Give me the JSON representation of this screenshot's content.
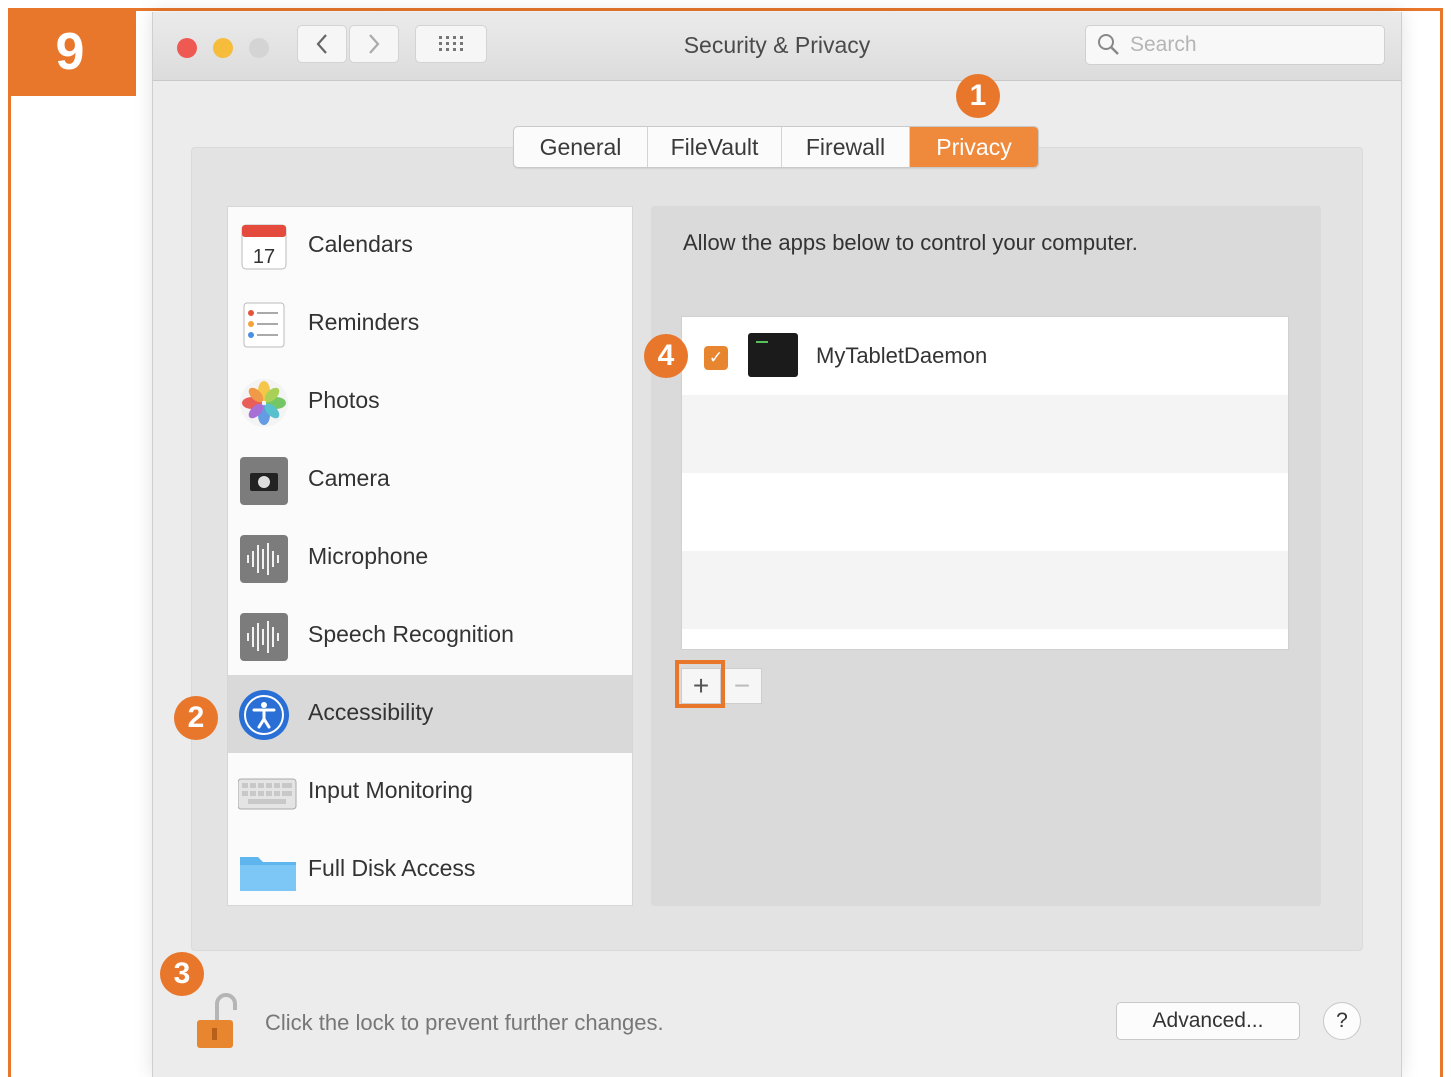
{
  "step": {
    "number": "9"
  },
  "window": {
    "title": "Security & Privacy",
    "search_placeholder": "Search"
  },
  "tabs": [
    {
      "label": "General",
      "active": false
    },
    {
      "label": "FileVault",
      "active": false
    },
    {
      "label": "Firewall",
      "active": false
    },
    {
      "label": "Privacy",
      "active": true
    }
  ],
  "sidebar": {
    "items": [
      {
        "label": "Calendars",
        "icon": "calendar-icon",
        "selected": false
      },
      {
        "label": "Reminders",
        "icon": "reminders-icon",
        "selected": false
      },
      {
        "label": "Photos",
        "icon": "photos-icon",
        "selected": false
      },
      {
        "label": "Camera",
        "icon": "camera-icon",
        "selected": false
      },
      {
        "label": "Microphone",
        "icon": "microphone-icon",
        "selected": false
      },
      {
        "label": "Speech Recognition",
        "icon": "speech-recognition-icon",
        "selected": false
      },
      {
        "label": "Accessibility",
        "icon": "accessibility-icon",
        "selected": true
      },
      {
        "label": "Input Monitoring",
        "icon": "keyboard-icon",
        "selected": false
      },
      {
        "label": "Full Disk Access",
        "icon": "folder-icon",
        "selected": false
      }
    ]
  },
  "panel": {
    "description": "Allow the apps below to control your computer.",
    "apps": [
      {
        "name": "MyTabletDaemon",
        "checked": true,
        "icon": "terminal-app-icon"
      }
    ],
    "add_label": "+",
    "remove_label": "−"
  },
  "footer": {
    "lock_text": "Click the lock to prevent further changes.",
    "advanced_label": "Advanced...",
    "help_label": "?"
  },
  "callouts": {
    "c1": "1",
    "c2": "2",
    "c3": "3",
    "c4": "4"
  },
  "colors": {
    "accent": "#e8762b",
    "tab_active": "#ef8a3c",
    "checkbox": "#e8862f"
  }
}
